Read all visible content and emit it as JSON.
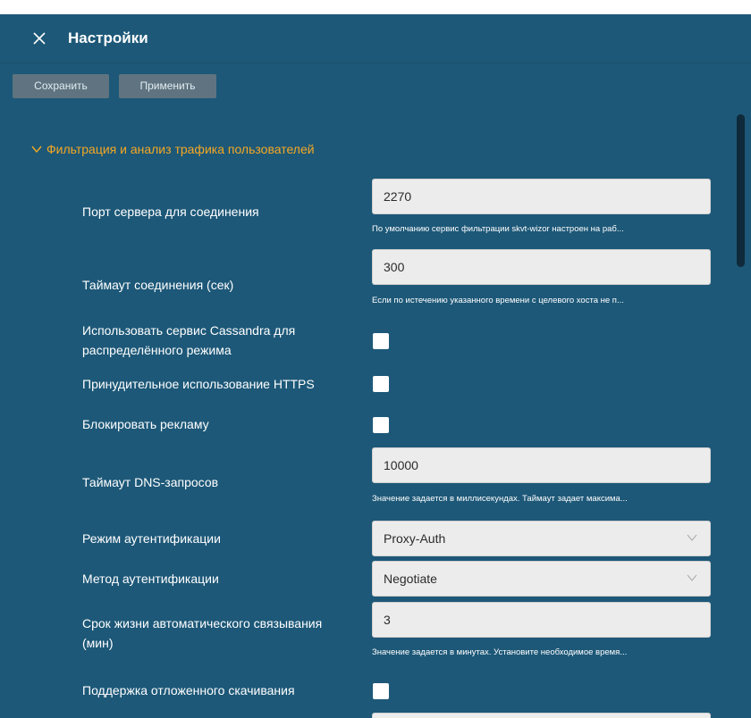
{
  "header": {
    "title": "Настройки",
    "close_icon": "close-icon"
  },
  "toolbar": {
    "save_label": "Сохранить",
    "apply_label": "Применить"
  },
  "section": {
    "title": "Фильтрация и анализ трафика пользователей",
    "expanded": true,
    "accent_color": "#f4a824"
  },
  "colors": {
    "panel_background": "#1d5878",
    "button_background": "#5f7480",
    "field_background": "#ececec"
  },
  "settings": {
    "server_port": {
      "label": "Порт сервера для соединения",
      "value": "2270",
      "hint": "По умолчанию сервис фильтрации skvt-wizor настроен на раб..."
    },
    "connection_timeout": {
      "label": "Таймаут соединения (сек)",
      "value": "300",
      "hint": "Если по истечению указанного времени с целевого хоста не п..."
    },
    "cassandra": {
      "label_line1": "Использовать сервис Cassandra для",
      "label_line2": "распределённого режима",
      "checked": false
    },
    "force_https": {
      "label": "Принудительное использование HTTPS",
      "checked": false
    },
    "block_ads": {
      "label": "Блокировать рекламу",
      "checked": false
    },
    "dns_timeout": {
      "label": "Таймаут DNS-запросов",
      "value": "10000",
      "hint": "Значение задается в миллисекундах. Таймаут задает максима..."
    },
    "auth_mode": {
      "label": "Режим аутентификации",
      "value": "Proxy-Auth"
    },
    "auth_method": {
      "label": "Метод аутентификации",
      "value": "Negotiate"
    },
    "auto_binding_lifetime": {
      "label_line1": "Срок жизни автоматического связывания",
      "label_line2": "(мин)",
      "value": "3",
      "hint": "Значение задается в минутах. Установите необходимое время..."
    },
    "deferred_download": {
      "label": "Поддержка отложенного скачивания",
      "checked": false
    }
  }
}
